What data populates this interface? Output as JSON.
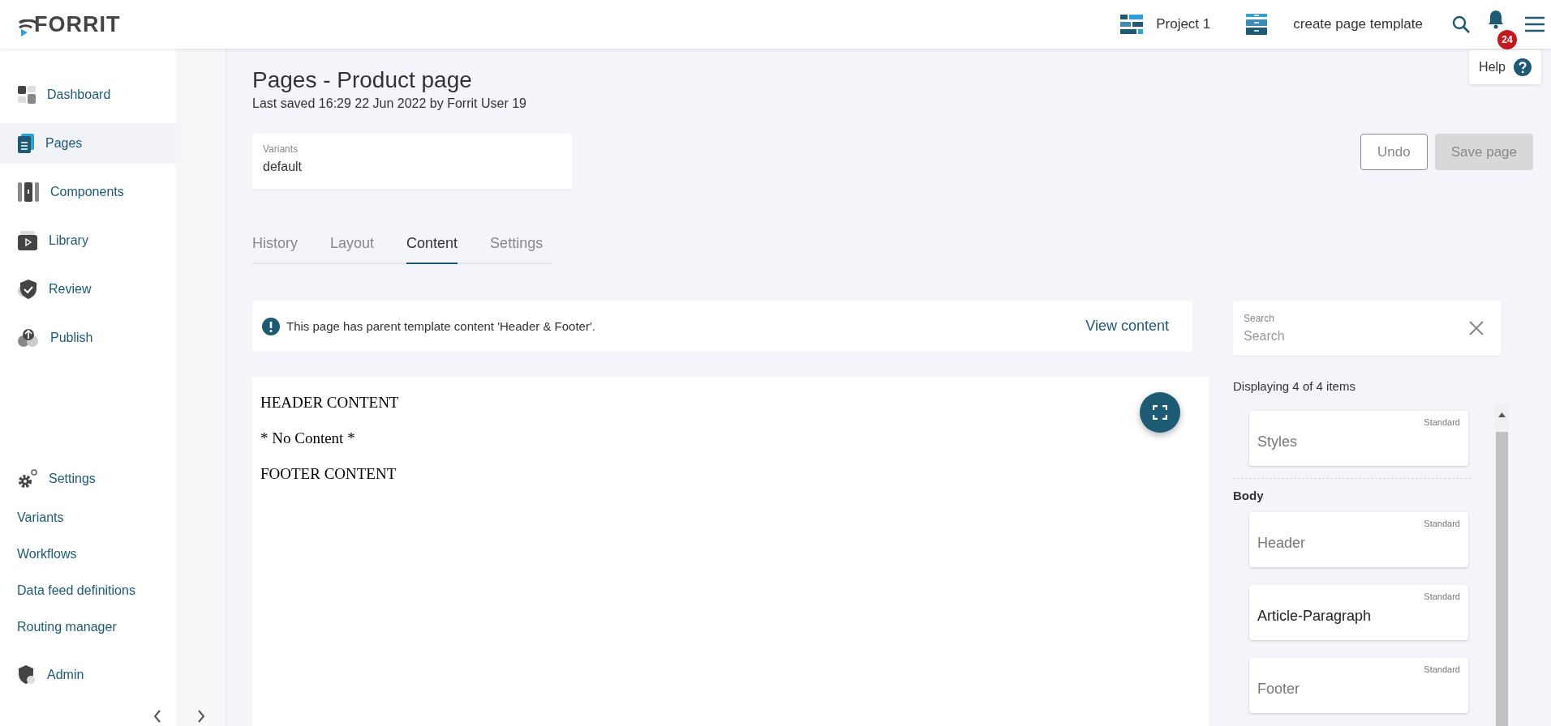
{
  "header": {
    "logo": "FORRIT",
    "project": "Project 1",
    "task": "create page template",
    "notifications": "24",
    "help": "Help"
  },
  "sidebar": {
    "items": [
      {
        "label": "Dashboard",
        "selected": false
      },
      {
        "label": "Pages",
        "selected": true
      },
      {
        "label": "Components",
        "selected": false
      },
      {
        "label": "Library",
        "selected": false
      },
      {
        "label": "Review",
        "selected": false
      },
      {
        "label": "Publish",
        "selected": false
      }
    ],
    "settings": {
      "label": "Settings",
      "links": [
        "Variants",
        "Workflows",
        "Data feed definitions",
        "Routing manager"
      ]
    },
    "admin": "Admin"
  },
  "page": {
    "title": "Pages - Product page",
    "last_saved": "Last saved 16:29 22 Jun 2022 by Forrit User 19",
    "variants": {
      "label": "Variants",
      "value": "default"
    },
    "buttons": [
      {
        "label": "Undo",
        "kind": "outline"
      },
      {
        "label": "Save page",
        "kind": "disabled"
      }
    ],
    "tabs": [
      {
        "label": "History",
        "selected": false
      },
      {
        "label": "Layout",
        "selected": false
      },
      {
        "label": "Content",
        "selected": true
      },
      {
        "label": "Settings",
        "selected": false
      }
    ],
    "notice": {
      "text": "This page has parent template content 'Header & Footer'.",
      "action": "View content"
    },
    "preview": [
      "HEADER CONTENT",
      "* No Content *",
      "FOOTER CONTENT"
    ]
  },
  "components": {
    "search": {
      "label": "Search",
      "placeholder": "Search"
    },
    "count": "Displaying 4 of 4 items",
    "groups": [
      {
        "items": [
          {
            "name": "Styles",
            "tag": "Standard",
            "inherited": true
          }
        ]
      },
      {
        "title": "Body",
        "items": [
          {
            "name": "Header",
            "tag": "Standard",
            "inherited": true
          },
          {
            "name": "Article-Paragraph",
            "tag": "Standard",
            "inherited": false
          },
          {
            "name": "Footer",
            "tag": "Standard",
            "inherited": true
          }
        ]
      }
    ]
  }
}
